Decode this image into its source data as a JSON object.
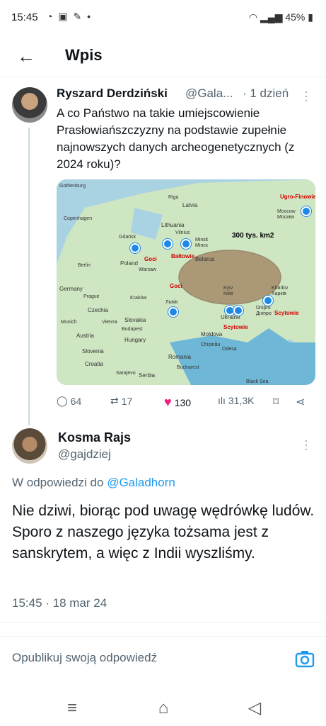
{
  "status": {
    "time": "15:45",
    "battery": "45%"
  },
  "header": {
    "title": "Wpis"
  },
  "tweet1": {
    "name": "Ryszard Derdziński",
    "handle": "@Gala...",
    "time": "· 1 dzień",
    "text": "A  co Państwo na takie umiejscowienie Prasłowiańszczyzny na podstawie zupełnie najnowszych danych archeogenetycznych (z 2024 roku)?",
    "map": {
      "area_label": "300 tys. km2",
      "groups": [
        "Ugro-Finowie",
        "Goci",
        "Bałtowie",
        "Goci",
        "Scytowie",
        "Scytowie"
      ],
      "places": [
        "Gothenburg",
        "Riga",
        "Latvia",
        "Moscow",
        "Москва",
        "Copenhagen",
        "Lithuania",
        "Vilnius",
        "Minsk",
        "Мінск",
        "Gdańsk",
        "Belarus",
        "Berlin",
        "Poland",
        "Warsaw",
        "Prague",
        "Kraków",
        "Львів",
        "Kyiv",
        "Київ",
        "Kharkiv",
        "Харків",
        "Czechia",
        "Slovakia",
        "Munich",
        "Vienna",
        "Budapest",
        "Ukraine",
        "Dnipro",
        "Дніпро",
        "Austria",
        "Hungary",
        "Moldova",
        "Chișinău",
        "Odesa",
        "Slovenia",
        "Croatia",
        "Romania",
        "Sarajevo",
        "Serbia",
        "Bucharest",
        "Black Sea",
        "Germany"
      ]
    },
    "stats": {
      "replies": "64",
      "reposts": "17",
      "likes": "130",
      "views": "31,3K"
    }
  },
  "tweet2": {
    "name": "Kosma Rajs",
    "handle": "@gajdziej",
    "reply_prefix": "W odpowiedzi do ",
    "reply_to": "@Galadhorn",
    "text": "Nie dziwi, biorąc pod uwagę wędrówkę ludów. Sporo z naszego języka tożsama jest z sanskrytem, a więc z Indii wyszliśmy.",
    "meta": "15:45 · 18 mar 24"
  },
  "compose": {
    "placeholder": "Opublikuj swoją odpowiedź"
  },
  "colors": {
    "like": "#f91880",
    "link": "#1d9bf0",
    "secondary": "#536471"
  }
}
